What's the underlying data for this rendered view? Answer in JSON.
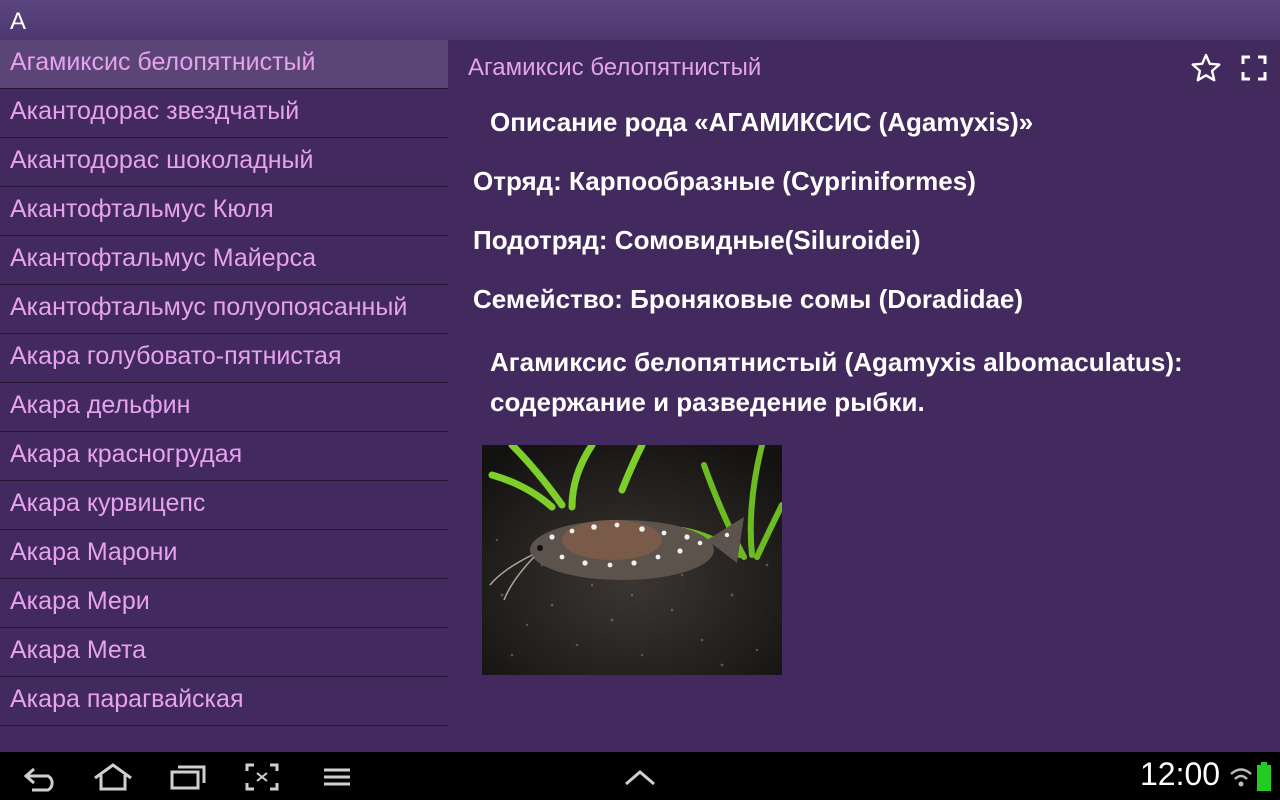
{
  "index_header": {
    "letter": "A"
  },
  "species_list": [
    {
      "label": "Агамиксис белопятнистый",
      "selected": true
    },
    {
      "label": "Акантодорас звездчатый"
    },
    {
      "label": "Акантодорас шоколадный"
    },
    {
      "label": "Акантофтальмус Кюля"
    },
    {
      "label": "Акантофтальмус Майерса"
    },
    {
      "label": "Акантофтальмус полуопоясанный"
    },
    {
      "label": "Акара голубовато-пятнистая"
    },
    {
      "label": "Акара дельфин"
    },
    {
      "label": "Акара красногрудая"
    },
    {
      "label": "Акара курвицепс"
    },
    {
      "label": "Акара Марони"
    },
    {
      "label": "Акара Мери"
    },
    {
      "label": "Акара Мета"
    },
    {
      "label": "Акара парагвайская"
    }
  ],
  "detail": {
    "title": "Агамиксис белопятнистый",
    "genus_heading": "Описание рода «АГАМИКСИС (Agamyxis)»",
    "order": "Отряд: Карпообразные (Cypriniformes)",
    "suborder": "Подотряд: Сомовидные(Siluroidei)",
    "family": "Семейство: Броняковые сомы (Doradidae)",
    "species_heading": "Агамиксис белопятнистый (Agamyxis albomaculatus): содержание и разведение рыбки.",
    "favorite_icon": "star-outline-icon",
    "fullscreen_icon": "fullscreen-icon"
  },
  "status_bar": {
    "time": "12:00",
    "icons": [
      "back-icon",
      "home-icon",
      "recent-apps-icon",
      "screenshot-icon",
      "menu-icon",
      "expand-up-icon",
      "wifi-icon",
      "battery-icon"
    ]
  },
  "colors": {
    "background": "#42295e",
    "list_text": "#e7a2ee",
    "selected_row": "#5a4576",
    "nav_bar": "#000000",
    "battery": "#22cc22"
  }
}
